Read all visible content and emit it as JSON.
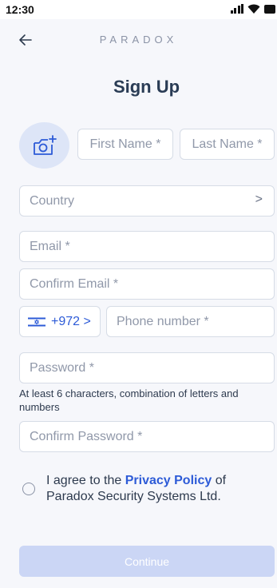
{
  "status_bar": {
    "time": "12:30",
    "icons": [
      "signal-icon",
      "wifi-icon",
      "battery-icon"
    ]
  },
  "header": {
    "back_icon": "arrow-left-icon",
    "brand": "PARADOX",
    "title": "Sign Up"
  },
  "form": {
    "avatar_icon": "camera-add-icon",
    "first_name_placeholder": "First Name *",
    "last_name_placeholder": "Last Name *",
    "country_placeholder": "Country",
    "country_chevron": ">",
    "email_placeholder": "Email *",
    "confirm_email_placeholder": "Confirm Email *",
    "phone_code": "+972 >",
    "phone_flag_icon": "israel-flag-icon",
    "phone_placeholder": "Phone number *",
    "password_placeholder": "Password *",
    "password_hint": "At least 6 characters, combination of letters and numbers",
    "confirm_password_placeholder": "Confirm Password *"
  },
  "agreement": {
    "prefix": "I agree to the ",
    "link": "Privacy Policy",
    "suffix": " of Paradox Security Systems Ltd."
  },
  "continue_label": "Continue",
  "colors": {
    "accent": "#2D5BD7",
    "button_disabled": "#CBD6F5",
    "background": "#F6F7FB",
    "title": "#2A3C55"
  }
}
